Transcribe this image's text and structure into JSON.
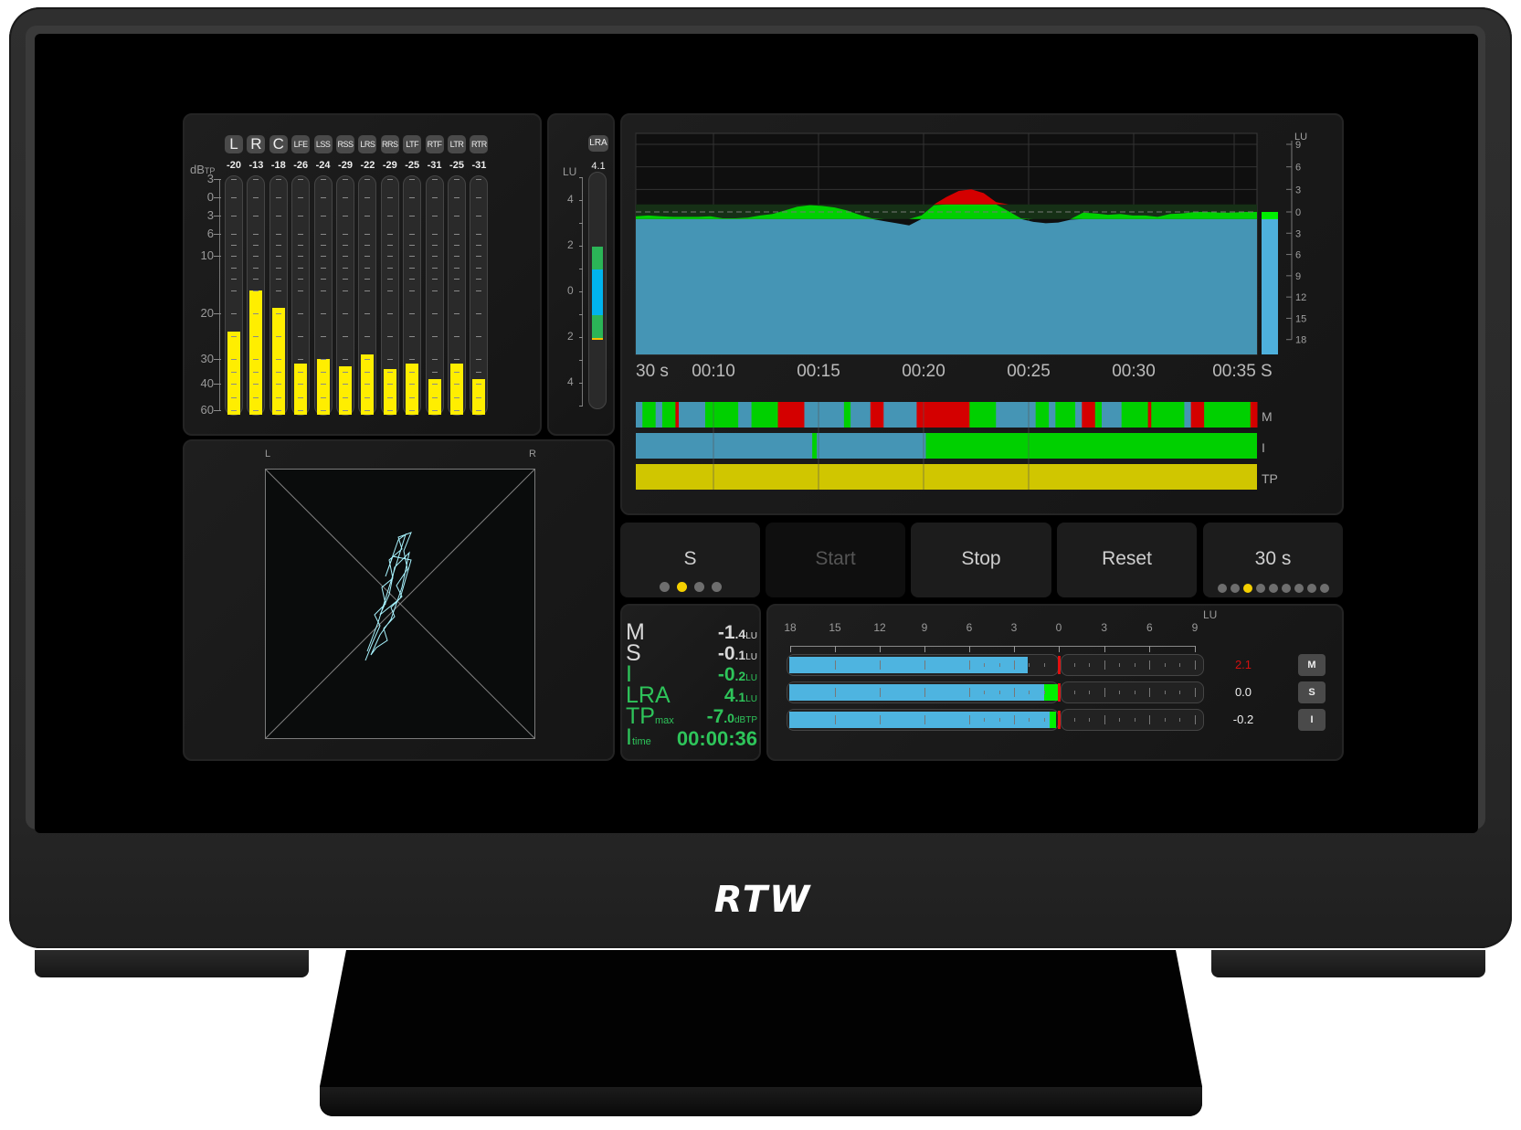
{
  "device": {
    "brand_logo": "RTW"
  },
  "colors": {
    "tp_bar": "#ffee00",
    "loudness_fill": "#4595b5",
    "in_range": "#00d000",
    "over": "#d40000",
    "lra_green": "#2bb557",
    "lra_blue": "#00b4ee",
    "readout_green": "#2ec45a",
    "tp_history": "#d0c600",
    "vector_trace": "#a8f4ff"
  },
  "tp_meter": {
    "unit_label": "dBTP",
    "unit_main": "dB",
    "unit_sub": "TP",
    "scale": [
      "3",
      "0",
      "3",
      "6",
      "10",
      "20",
      "30",
      "40",
      "60"
    ],
    "channels": [
      {
        "name": "L",
        "peak": "-20",
        "level_db": -24
      },
      {
        "name": "R",
        "peak": "-13",
        "level_db": -16
      },
      {
        "name": "C",
        "peak": "-18",
        "level_db": -19
      },
      {
        "name": "LFE",
        "peak": "-26",
        "level_db": -32
      },
      {
        "name": "LSS",
        "peak": "-24",
        "level_db": -30
      },
      {
        "name": "RSS",
        "peak": "-29",
        "level_db": -33
      },
      {
        "name": "LRS",
        "peak": "-22",
        "level_db": -29
      },
      {
        "name": "RRS",
        "peak": "-29",
        "level_db": -34
      },
      {
        "name": "LTF",
        "peak": "-25",
        "level_db": -32
      },
      {
        "name": "RTF",
        "peak": "-31",
        "level_db": -38
      },
      {
        "name": "LTR",
        "peak": "-25",
        "level_db": -32
      },
      {
        "name": "RTR",
        "peak": "-31",
        "level_db": -38
      }
    ]
  },
  "lra_meter": {
    "label": "LRA",
    "value": "4.1",
    "unit": "LU",
    "scale": [
      "4",
      "2",
      "0",
      "2",
      "4"
    ],
    "range_low_lu": -2,
    "range_high_lu": 2,
    "core_low_lu": -1,
    "core_high_lu": 1
  },
  "loudness_graph": {
    "unit": "LU",
    "right_scale": [
      "9",
      "6",
      "3",
      "0",
      "3",
      "6",
      "9",
      "12",
      "15",
      "18"
    ],
    "time_window_label": "30 s",
    "time_labels": [
      "00:10",
      "00:15",
      "00:20",
      "00:25",
      "00:30",
      "00:35"
    ],
    "mode_label": "S",
    "current_s_lu": 0.0,
    "history_labels": {
      "m": "M",
      "i": "I",
      "tp": "TP"
    }
  },
  "controls": {
    "mode_button": {
      "label": "S",
      "dots": 4,
      "active_dot": 2
    },
    "start_button": {
      "label": "Start",
      "enabled": false
    },
    "stop_button": {
      "label": "Stop"
    },
    "reset_button": {
      "label": "Reset"
    },
    "window_button": {
      "label": "30 s",
      "dots": 9,
      "active_dot": 3
    }
  },
  "readouts": [
    {
      "key": "M",
      "sub": "",
      "big": "-1",
      "small": ".4",
      "unit": "LU",
      "color": "white"
    },
    {
      "key": "S",
      "sub": "",
      "big": "-0",
      "small": ".1",
      "unit": "LU",
      "color": "white"
    },
    {
      "key": "I",
      "sub": "",
      "big": "-0",
      "small": ".2",
      "unit": "LU",
      "color": "green"
    },
    {
      "key": "LRA",
      "sub": "",
      "big": "4",
      "small": ".1",
      "unit": "LU",
      "color": "green"
    },
    {
      "key": "TP",
      "sub": "max",
      "big": "-7",
      "small": ".0",
      "unit": "dBTP",
      "color": "green"
    },
    {
      "key": "I",
      "sub": "time",
      "big": "00:00:36",
      "small": "",
      "unit": "",
      "color": "green"
    }
  ],
  "bar_meters": {
    "unit": "LU",
    "scale": [
      "18",
      "15",
      "12",
      "9",
      "6",
      "3",
      "0",
      "3",
      "6",
      "9"
    ],
    "bars": [
      {
        "button": "M",
        "value": "2.1",
        "value_color": "#d01010",
        "level_lu": -2.1,
        "green_from_lu": null
      },
      {
        "button": "S",
        "value": "0.0",
        "value_color": "#eeeeee",
        "level_lu": 0.0,
        "green_from_lu": -1.0
      },
      {
        "button": "I",
        "value": "-0.2",
        "value_color": "#eeeeee",
        "level_lu": -0.2,
        "green_from_lu": -0.6
      }
    ]
  },
  "vectorscope": {
    "left_label": "L",
    "right_label": "R"
  }
}
